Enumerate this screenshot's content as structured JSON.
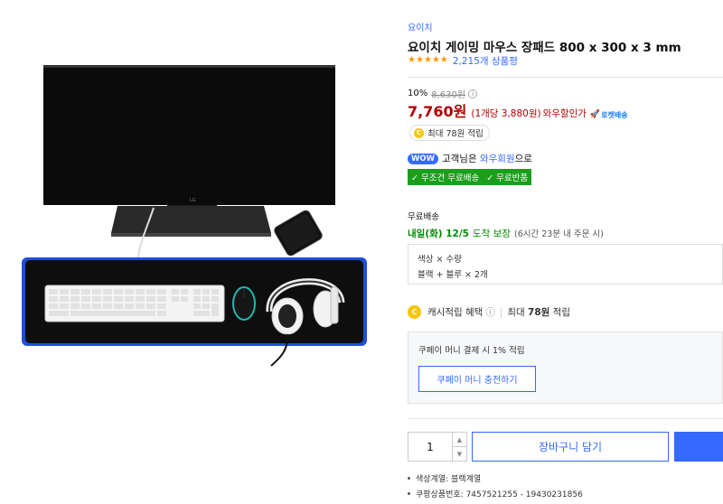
{
  "product": {
    "brand": "요이치",
    "title": "요이치 게이밍 마우스 장패드 800 x 300 x 3 mm",
    "rating_stars": 5,
    "review_count_text": "2,215개 상품평"
  },
  "price": {
    "discount_rate": "10%",
    "original_price": "8,630원",
    "sale_price": "7,760원",
    "unit_price": "(1개당 3,880원)",
    "wow_discount": "와우할인가",
    "rocket_label": "로켓배송",
    "rocket_icon": "rocket-icon"
  },
  "cash": {
    "pill_text": "최대 78원 적립",
    "coin_symbol": "C"
  },
  "wow": {
    "badge": "WOW",
    "text_prefix": "고객님은",
    "link_text": "와우회원",
    "text_suffix": "으로",
    "benefits": [
      "✓ 무조건 무료배송",
      "✓ 무료반품"
    ]
  },
  "shipping": {
    "title": "무료배송",
    "date": "내일(화) 12/5",
    "arrival": "도착 보장",
    "remaining": "(6시간 23분 내 주문 시)"
  },
  "option": {
    "label": "색상 × 수량",
    "value": "블랙 + 블루 × 2개"
  },
  "cash_benefit": {
    "label": "캐시적립 혜택",
    "info_icon": "ⓘ",
    "separator": "|",
    "max_label": "최대",
    "max_amount": "78원",
    "max_suffix": "적립"
  },
  "coupay": {
    "text": "쿠페이 머니 결제 시 1% 적립",
    "button": "쿠페이 머니 충전하기"
  },
  "purchase": {
    "quantity": "1",
    "cart_button": "장바구니 담기",
    "buy_button": ""
  },
  "details": [
    "색상계열: 블랙계열",
    "쿠팡상품번호: 7457521255 - 19430231856"
  ],
  "colors": {
    "accent": "#346aff",
    "price": "#ae0000",
    "benefit_green": "#1b9e1b",
    "delivery_green": "#008c00",
    "star": "#ff9600",
    "coin": "#f6c700",
    "mousepad_border": "#1e4fd8"
  }
}
